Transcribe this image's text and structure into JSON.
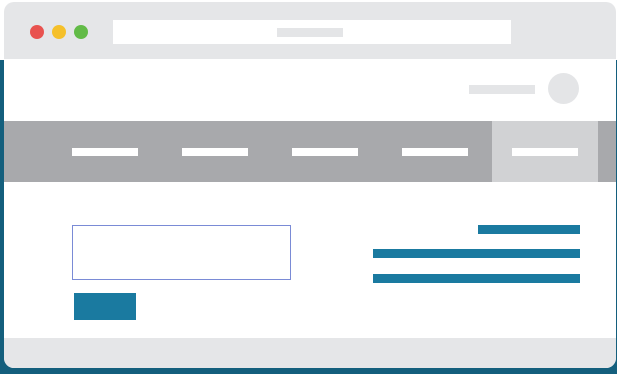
{
  "window": {
    "traffic_lights": [
      {
        "name": "close",
        "color": "#e8524f"
      },
      {
        "name": "minimize",
        "color": "#f5c02a"
      },
      {
        "name": "maximize",
        "color": "#62bb47"
      }
    ],
    "address_bar": {
      "text": ""
    }
  },
  "header": {
    "username": "",
    "avatar_icon": "user-avatar"
  },
  "nav": {
    "items": [
      {
        "label": "",
        "active": false
      },
      {
        "label": "",
        "active": false
      },
      {
        "label": "",
        "active": false
      },
      {
        "label": "",
        "active": false
      },
      {
        "label": "",
        "active": true
      }
    ]
  },
  "content": {
    "input_value": "",
    "submit_label": "",
    "text_lines": [
      "",
      "",
      ""
    ]
  },
  "colors": {
    "accent": "#1a7aa0",
    "nav_bg": "#a8a9ac",
    "nav_active": "#d1d2d4",
    "chrome": "#e5e6e8",
    "backdrop": "#145f7d"
  }
}
